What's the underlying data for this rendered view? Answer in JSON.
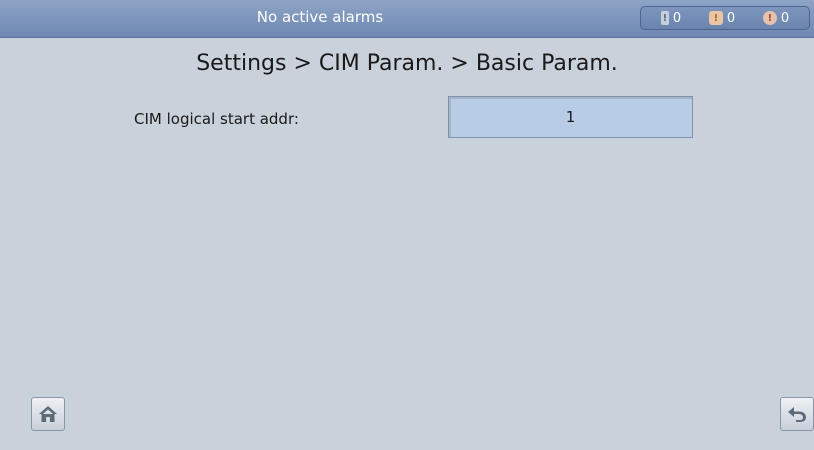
{
  "status_bar": {
    "alarm_text": "No active alarms",
    "counters": [
      {
        "name": "minor",
        "count": "0",
        "icon": "minor-alarm-icon",
        "color": "#c7cfdc"
      },
      {
        "name": "major",
        "count": "0",
        "icon": "major-alarm-icon",
        "color": "#e9c5a5"
      },
      {
        "name": "critical",
        "count": "0",
        "icon": "critical-alarm-icon",
        "color": "#e6c1ad"
      }
    ]
  },
  "breadcrumb": "Settings > CIM Param. > Basic Param.",
  "fields": [
    {
      "label": "CIM logical start addr:",
      "value": "1"
    }
  ],
  "footer": {
    "home_icon": "home-icon",
    "back_icon": "back-arrow-icon"
  }
}
